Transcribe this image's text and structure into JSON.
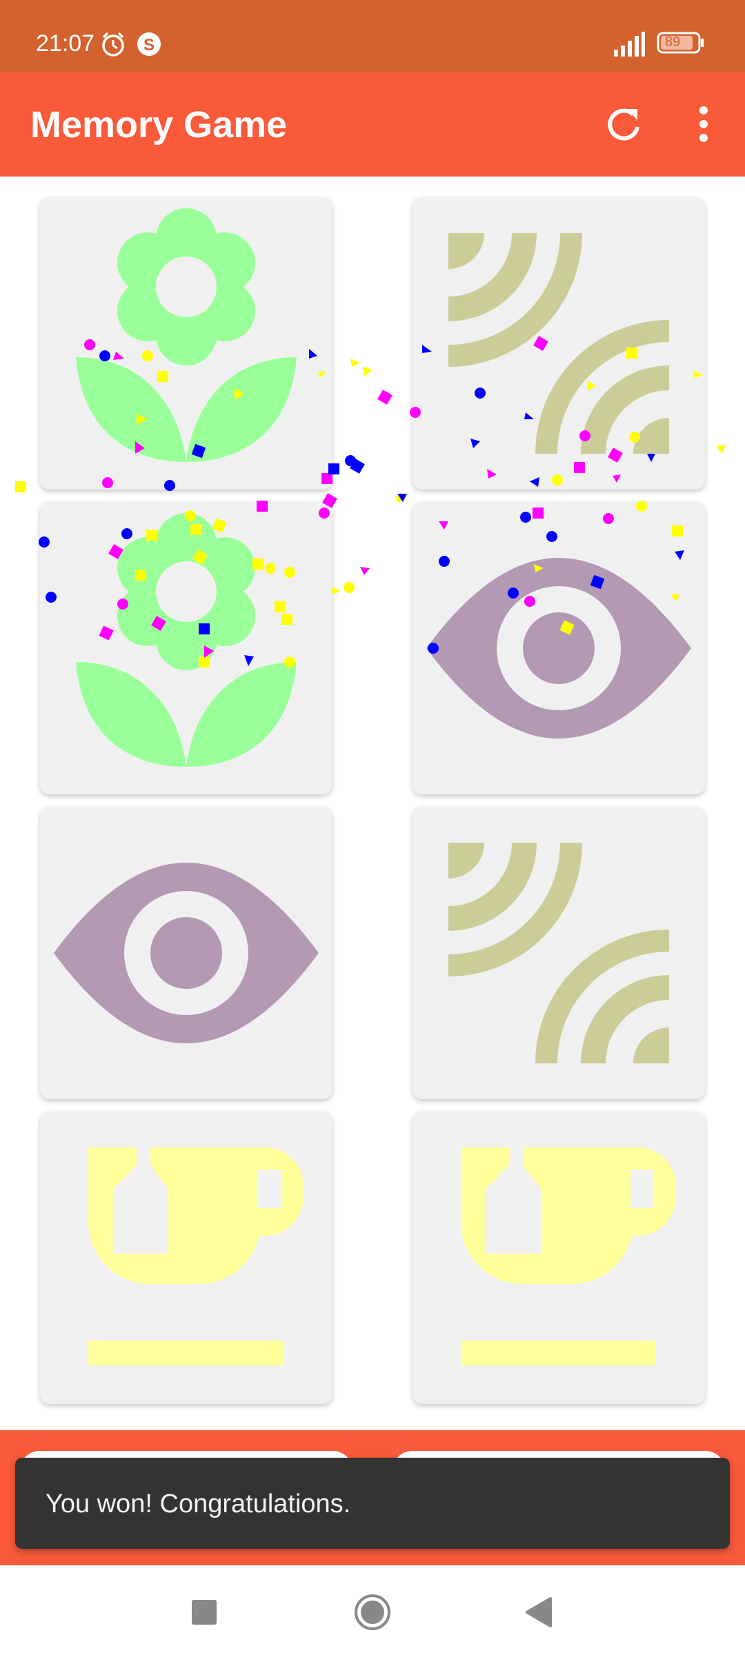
{
  "status_bar": {
    "time": "21:07",
    "icons": [
      "alarm-icon",
      "s-app-icon",
      "signal-icon",
      "battery-icon"
    ],
    "battery": "89"
  },
  "app_bar": {
    "title": "Memory Game",
    "actions": [
      "refresh-icon",
      "more-vert-icon"
    ],
    "color": "#f85a3a"
  },
  "cards": [
    {
      "icon": "flower-icon",
      "color": "#99ff99"
    },
    {
      "icon": "rss-feed-icon",
      "color": "#cccc99"
    },
    {
      "icon": "flower-icon",
      "color": "#99ff99"
    },
    {
      "icon": "eye-icon",
      "color": "#b399b3"
    },
    {
      "icon": "eye-icon",
      "color": "#b399b3"
    },
    {
      "icon": "rss-feed-icon",
      "color": "#cccc99"
    },
    {
      "icon": "tea-cup-icon",
      "color": "#ffff99"
    },
    {
      "icon": "tea-cup-icon",
      "color": "#ffff99"
    }
  ],
  "snackbar": {
    "message": "You won! Congratulations."
  },
  "nav_bar": {
    "buttons": [
      "recents-square-icon",
      "home-circle-icon",
      "back-triangle-icon"
    ]
  },
  "confetti_colors": [
    "#ff00ff",
    "#0000ff",
    "#ffff00"
  ]
}
